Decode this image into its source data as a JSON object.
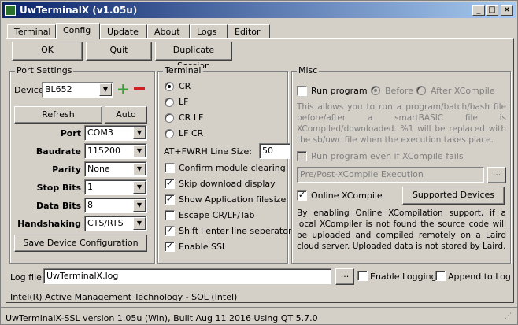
{
  "window": {
    "title": "UwTerminalX (v1.05u)"
  },
  "tabs": [
    "Terminal",
    "Config",
    "Update",
    "About",
    "Logs",
    "Editor"
  ],
  "toolbar": {
    "ok": "OK",
    "quit": "Quit",
    "duplicate": "Duplicate Session"
  },
  "port": {
    "group_title": "Port Settings",
    "device_label": "Device",
    "device_value": "BL652",
    "refresh": "Refresh",
    "auto": "Auto",
    "port_label": "Port",
    "port_value": "COM3",
    "baud_label": "Baudrate",
    "baud_value": "115200",
    "parity_label": "Parity",
    "parity_value": "None",
    "stop_label": "Stop Bits",
    "stop_value": "1",
    "data_label": "Data Bits",
    "data_value": "8",
    "hand_label": "Handshaking",
    "hand_value": "CTS/RTS",
    "save": "Save Device Configuration"
  },
  "terminal": {
    "group_title": "Terminal",
    "cr": "CR",
    "lf": "LF",
    "crlf": "CR LF",
    "lfcr": "LF CR",
    "fwrh_label": "AT+FWRH Line Size:",
    "fwrh_value": "50",
    "confirm_clear": "Confirm module clearing",
    "skip_download": "Skip download display",
    "show_filesize": "Show Application filesize",
    "escape": "Escape CR/LF/Tab",
    "shift_enter": "Shift+enter line seperator",
    "ssl": "Enable SSL"
  },
  "misc": {
    "group_title": "Misc",
    "run_program": "Run program",
    "before": "Before",
    "after": "After XCompile",
    "description": "This allows you to run a program/batch/bash file before/after a smartBASIC file is XCompiled/downloaded. %1 will be replaced with the sb/uwc file when the execution takes place.",
    "run_even_fail": "Run program even if XCompile fails",
    "exec_placeholder": "Pre/Post-XCompile Execution",
    "browse": "...",
    "online_xcompile": "Online XCompile",
    "supported_devices": "Supported Devices",
    "online_description": "By enabling Online XCompilation support, if a local XCompiler is not found the source code will be uploaded and compiled remotely on a Laird cloud server. Uploaded data is not stored by Laird."
  },
  "log": {
    "label": "Log file:",
    "value": "UwTerminalX.log",
    "browse": "...",
    "enable_logging": "Enable Logging",
    "append": "Append to Log"
  },
  "device_info": "Intel(R) Active Management Technology - SOL (Intel)",
  "status": "UwTerminalX-SSL version 1.05u (Win), Built Aug 11 2016 Using QT 5.7.0"
}
